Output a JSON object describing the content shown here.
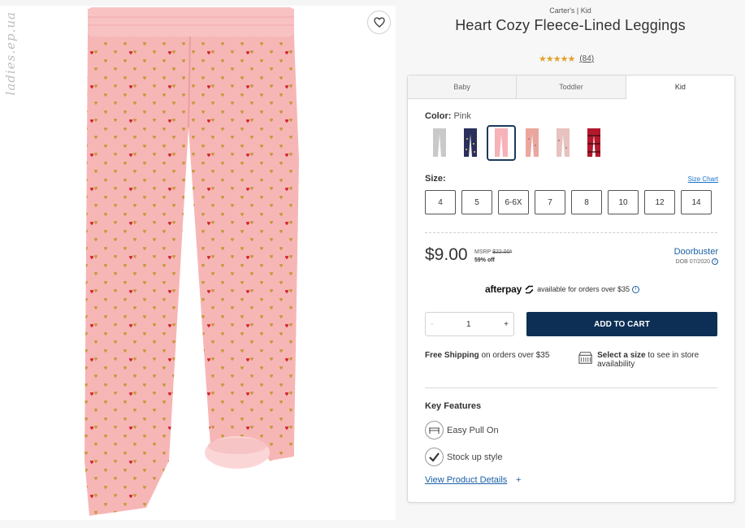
{
  "watermark": "ladies.ep.ua",
  "product": {
    "brand": "Carter's | Kid",
    "title": "Heart Cozy Fleece-Lined Leggings",
    "stars": "★★★★★",
    "review_count": "(84)",
    "rating_value": 4.5
  },
  "tabs": [
    "Baby",
    "Toddler",
    "Kid"
  ],
  "color": {
    "label": "Color:",
    "selected": "Pink",
    "swatch_colors": [
      "#c9c9c9",
      "#2a2f5c",
      "#f6b2b7",
      "#e9a79f",
      "#e7c2bf",
      "#b2182b"
    ]
  },
  "size": {
    "label": "Size:",
    "chart_link": "Size Chart",
    "options": [
      "4",
      "5",
      "6-6X",
      "7",
      "8",
      "10",
      "12",
      "14"
    ]
  },
  "price": {
    "current": "$9.00",
    "msrp_label": "MSRP",
    "msrp_value": "$22.00*",
    "discount": "59% off",
    "deal_link": "Doorbuster",
    "deal_date": "DOB 07/2020"
  },
  "afterpay": {
    "logo": "afterpay",
    "text": "available for orders over $35"
  },
  "cart": {
    "minus": "-",
    "quantity": "1",
    "plus": "+",
    "add_label": "ADD TO CART"
  },
  "shipping": {
    "bold": "Free Shipping",
    "rest": "on orders over $35"
  },
  "store": {
    "bold": "Select a size",
    "rest": "to see in store availability"
  },
  "features": {
    "title": "Key Features",
    "items": [
      "Easy Pull On",
      "Stock up style"
    ],
    "details_link": "View Product Details",
    "details_plus": "+"
  }
}
